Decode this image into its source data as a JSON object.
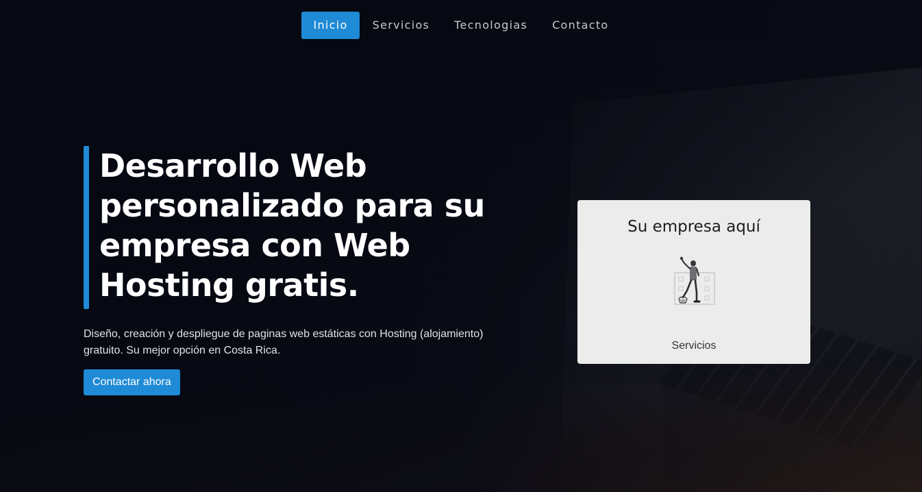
{
  "nav": {
    "items": [
      {
        "label": "Inicio",
        "active": true
      },
      {
        "label": "Servicios",
        "active": false
      },
      {
        "label": "Tecnologias",
        "active": false
      },
      {
        "label": "Contacto",
        "active": false
      }
    ]
  },
  "hero": {
    "title": "Desarrollo Web personalizado para su empresa con Web Hosting gratis.",
    "description": "Diseño, creación y despliegue de paginas web estáticas con Hosting (alojamiento) gratuito. Su mejor opción en Costa Rica.",
    "cta_label": "Contactar ahora"
  },
  "card": {
    "title": "Su empresa aquí",
    "illustration": "person-with-building-illustration",
    "caption": "Servicios"
  },
  "colors": {
    "accent": "#1f8ad6",
    "background": "#070913",
    "card_background": "#ececec",
    "text_light": "#ffffff"
  }
}
